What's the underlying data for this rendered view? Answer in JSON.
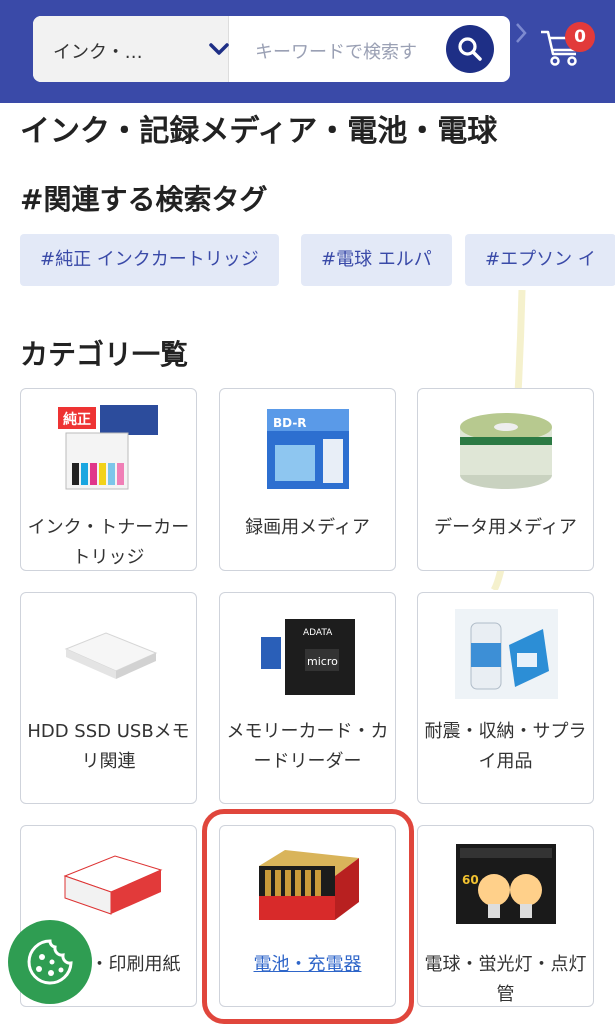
{
  "header": {
    "category_select": "インク・…",
    "search_placeholder": "キーワードで検索す",
    "cart_count": "0",
    "colors": {
      "bar": "#3a4aa8",
      "search_button": "#1e2f86",
      "badge": "#e23a3a"
    }
  },
  "page": {
    "title": "インク・記録メディア・電池・電球"
  },
  "tags": {
    "heading": "#関連する検索タグ",
    "items": [
      {
        "label": "#純正 インクカートリッジ"
      },
      {
        "label": "#電球 エルパ"
      },
      {
        "label": "#エプソン イ"
      }
    ]
  },
  "categories": {
    "heading": "カテゴリ一覧",
    "items": [
      {
        "label": "インク・トナーカートリッジ",
        "icon": "ink-cartridge-image"
      },
      {
        "label": "録画用メディア",
        "icon": "bd-r-disc-image"
      },
      {
        "label": "データ用メディア",
        "icon": "dvd-spindle-image"
      },
      {
        "label": "HDD SSD USBメモリ関連",
        "icon": "external-hdd-image"
      },
      {
        "label": "メモリーカード・カードリーダー",
        "icon": "microsd-card-image"
      },
      {
        "label": "耐震・収納・サプライ用品",
        "icon": "cleaning-wipes-image"
      },
      {
        "label": "ー用紙・印刷用紙",
        "icon": "copy-paper-image"
      },
      {
        "label": "電池・充電器",
        "icon": "batteries-image",
        "selected": true
      },
      {
        "label": "電球・蛍光灯・点灯管",
        "icon": "led-bulb-image"
      }
    ]
  },
  "cookie_button": {
    "icon": "cookie-icon"
  }
}
